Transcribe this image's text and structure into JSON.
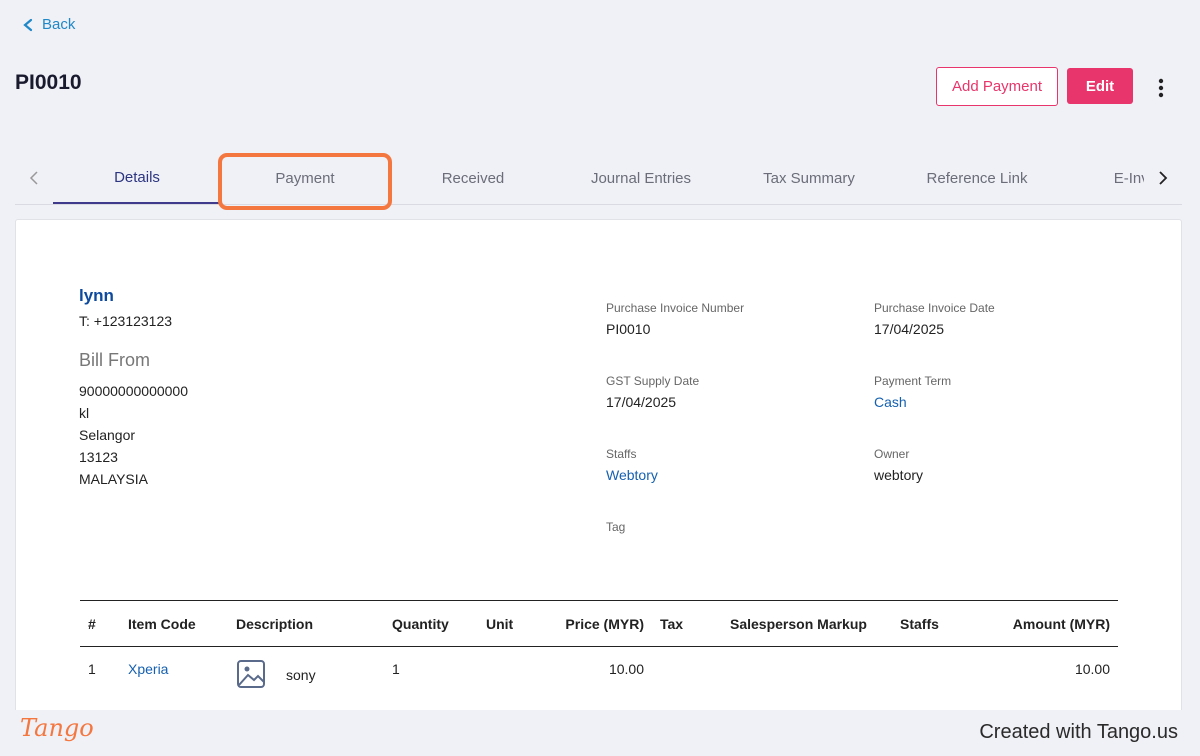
{
  "nav": {
    "back_label": "Back"
  },
  "header": {
    "title": "PI0010",
    "add_payment_label": "Add Payment",
    "edit_label": "Edit",
    "accent_color": "#e8356b"
  },
  "tabs": [
    {
      "label": "Details",
      "active": true
    },
    {
      "label": "Payment",
      "active": false
    },
    {
      "label": "Received",
      "active": false
    },
    {
      "label": "Journal Entries",
      "active": false
    },
    {
      "label": "Tax Summary",
      "active": false
    },
    {
      "label": "Reference Link",
      "active": false
    },
    {
      "label": "E-Invoice",
      "active": false
    }
  ],
  "vendor": {
    "name": "lynn",
    "phone": "T: +123123123",
    "bill_from_heading": "Bill From",
    "address": [
      "90000000000000",
      "kl",
      "Selangor",
      "13123",
      "MALAYSIA"
    ]
  },
  "fields": {
    "invoice_number": {
      "label": "Purchase Invoice Number",
      "value": "PI0010"
    },
    "invoice_date": {
      "label": "Purchase Invoice Date",
      "value": "17/04/2025"
    },
    "gst_date": {
      "label": "GST Supply Date",
      "value": "17/04/2025"
    },
    "payment_term": {
      "label": "Payment Term",
      "value": "Cash"
    },
    "staffs": {
      "label": "Staffs",
      "value": "Webtory"
    },
    "owner": {
      "label": "Owner",
      "value": "webtory"
    },
    "tag": {
      "label": "Tag",
      "value": ""
    }
  },
  "table": {
    "headers": [
      "#",
      "Item Code",
      "Description",
      "Quantity",
      "Unit",
      "Price (MYR)",
      "Tax",
      "Salesperson Markup",
      "Staffs",
      "Amount (MYR)"
    ],
    "rows": [
      {
        "num": "1",
        "item_code": "Xperia",
        "description": "sony",
        "quantity": "1",
        "unit": "",
        "price": "10.00",
        "tax": "",
        "markup": "",
        "staffs": "",
        "amount": "10.00"
      }
    ]
  },
  "footer": {
    "logo": "Tango",
    "created": "Created with Tango.us"
  }
}
